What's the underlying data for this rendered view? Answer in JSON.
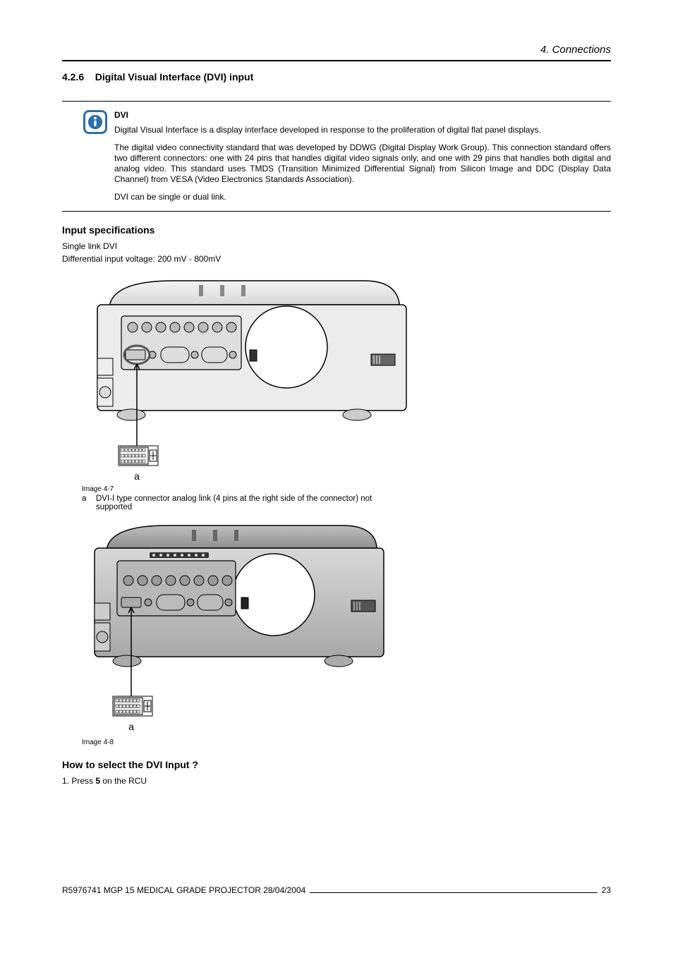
{
  "header": {
    "chapter": "4.  Connections"
  },
  "section": {
    "number": "4.2.6",
    "title": "Digital Visual Interface (DVI) input"
  },
  "info": {
    "title": "DVI",
    "p1": "Digital Visual Interface is a display interface developed in response to the proliferation of digital flat panel displays.",
    "p2": "The digital video connectivity standard that was developed by DDWG (Digital Display Work Group).  This connection standard offers two different connectors: one with 24 pins that handles digital video signals only, and one with 29 pins that handles both digital and analog video.  This standard uses TMDS (Transition Minimized Differential Signal) from Silicon Image and DDC (Display Data Channel) from VESA (Video Electronics Standards Association).",
    "p3": "DVI can be single or dual link."
  },
  "input_spec": {
    "heading": "Input specifications",
    "line1": "Single link DVI",
    "line2": "Differential input voltage: 200 mV - 800mV"
  },
  "fig1": {
    "caption": "Image 4-7",
    "legend_label": "a",
    "legend_text": "DVI-I type connector analog link (4 pins at the right side of the connector) not supported",
    "callout": "a"
  },
  "fig2": {
    "caption": "Image 4-8",
    "callout": "a"
  },
  "howto": {
    "heading": "How to select the DVI Input ?",
    "step_prefix": "1.  Press ",
    "step_bold": "5",
    "step_suffix": " on the RCU"
  },
  "footer": {
    "left": "R5976741  MGP 15 MEDICAL GRADE PROJECTOR  28/04/2004",
    "page": "23"
  }
}
